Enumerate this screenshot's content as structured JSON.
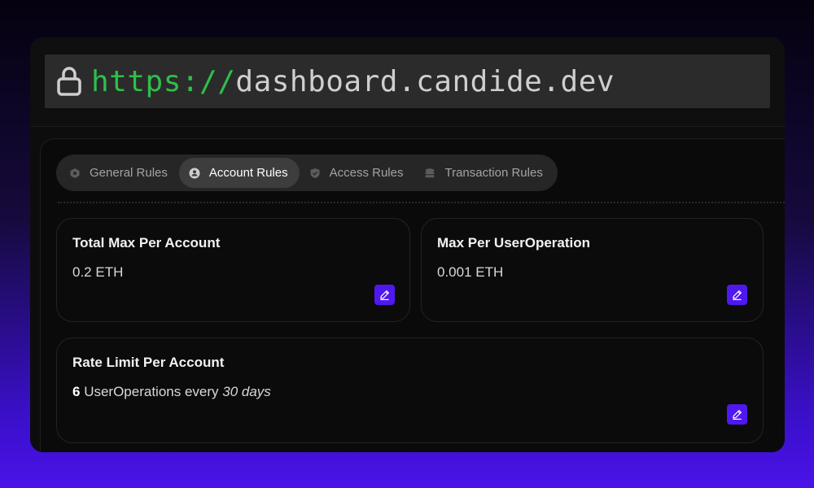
{
  "browser": {
    "url_scheme": "https://",
    "url_host": "dashboard.candide.dev",
    "lock_icon": "lock-icon"
  },
  "tabs": [
    {
      "label": "General Rules",
      "icon": "hexagon-icon",
      "active": false
    },
    {
      "label": "Account Rules",
      "icon": "user-icon",
      "active": true
    },
    {
      "label": "Access Rules",
      "icon": "shield-check-icon",
      "active": false
    },
    {
      "label": "Transaction Rules",
      "icon": "coins-icon",
      "active": false
    }
  ],
  "cards": {
    "total_max": {
      "title": "Total Max Per Account",
      "value": "0.2 ETH"
    },
    "max_per_op": {
      "title": "Max Per UserOperation",
      "value": "0.001 ETH"
    },
    "rate_limit": {
      "title": "Rate Limit Per Account",
      "count": "6",
      "middle": " UserOperations every ",
      "period": "30 days"
    }
  },
  "colors": {
    "accent": "#4f18f0",
    "url_scheme": "#2fbf4a",
    "background_gradient_top": "#05010f",
    "background_gradient_bottom": "#4a12e8"
  }
}
